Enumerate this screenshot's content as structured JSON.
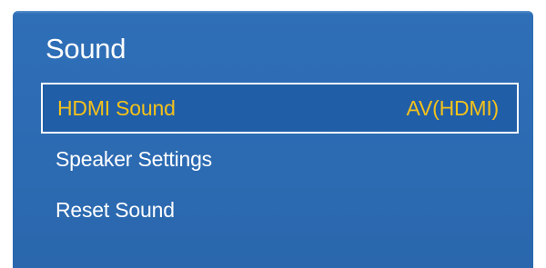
{
  "menu": {
    "title": "Sound",
    "items": [
      {
        "label": "HDMI Sound",
        "value": "AV(HDMI)",
        "selected": true
      },
      {
        "label": "Speaker Settings",
        "value": ""
      },
      {
        "label": "Reset Sound",
        "value": ""
      }
    ]
  },
  "colors": {
    "panel_background": "#2d6cb4",
    "selected_text": "#f4c21a",
    "text": "#ffffff",
    "selection_border": "#ffffff"
  }
}
